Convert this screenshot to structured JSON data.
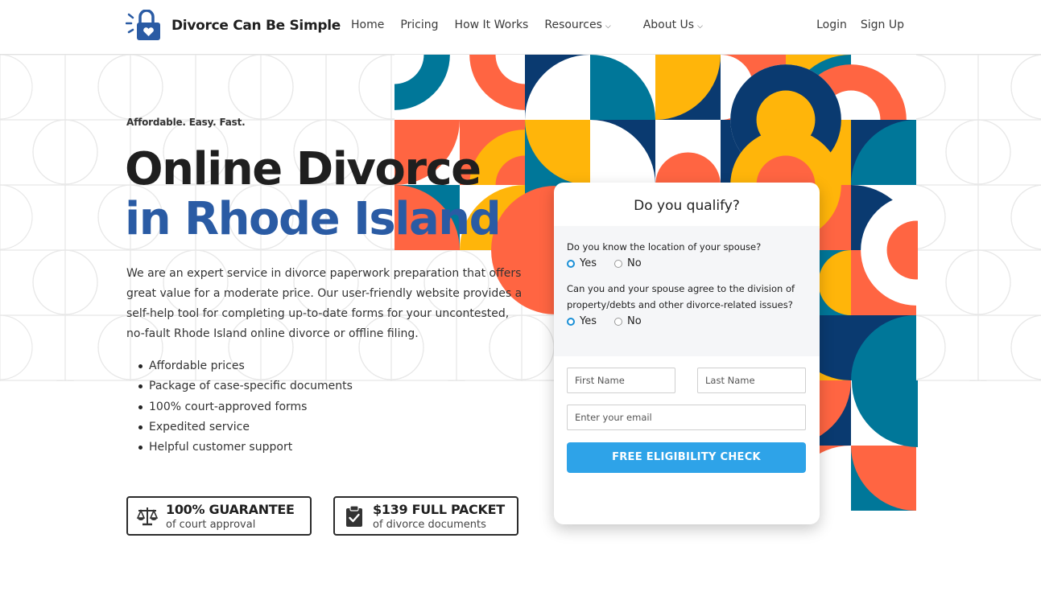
{
  "header": {
    "brand": "Divorce Can Be Simple",
    "nav": [
      {
        "label": "Home"
      },
      {
        "label": "Pricing"
      },
      {
        "label": "How It Works"
      },
      {
        "label": "Resources",
        "dropdown": true
      },
      {
        "label": "About Us",
        "dropdown": true
      }
    ],
    "login": "Login",
    "signup": "Sign Up"
  },
  "hero": {
    "tagline": "Affordable. Easy. Fast.",
    "title_line1": "Online Divorce",
    "title_line2": "in Rhode Island",
    "description": "We are an expert service in divorce paperwork preparation that offers great value for a moderate price. Our user-friendly website provides a self-help tool for completing up-to-date forms for your uncontested, no-fault Rhode Island online divorce or offline filing.",
    "features": [
      "Affordable prices",
      "Package of case-specific documents",
      "100% court-approved forms",
      "Expedited service",
      "Helpful customer support"
    ]
  },
  "badges": [
    {
      "icon": "scales-icon",
      "title": "100% GUARANTEE",
      "subtitle": "of court approval"
    },
    {
      "icon": "clipboard-check-icon",
      "title": "$139 FULL PACKET",
      "subtitle": "of divorce documents"
    }
  ],
  "qualify": {
    "title": "Do you qualify?",
    "q1": "Do you know the location of your spouse?",
    "q2": "Can you and your spouse agree to the division of property/debts and other divorce-related issues?",
    "yes": "Yes",
    "no": "No",
    "first_name_placeholder": "First Name",
    "last_name_placeholder": "Last Name",
    "email_placeholder": "Enter your email",
    "cta": "FREE ELIGIBILITY CHECK"
  },
  "colors": {
    "brand_blue": "#2a5ba4",
    "navy": "#0a3a70",
    "teal": "#007799",
    "orange": "#ff6542",
    "yellow": "#ffb50a",
    "cta_blue": "#2ea3e8"
  }
}
